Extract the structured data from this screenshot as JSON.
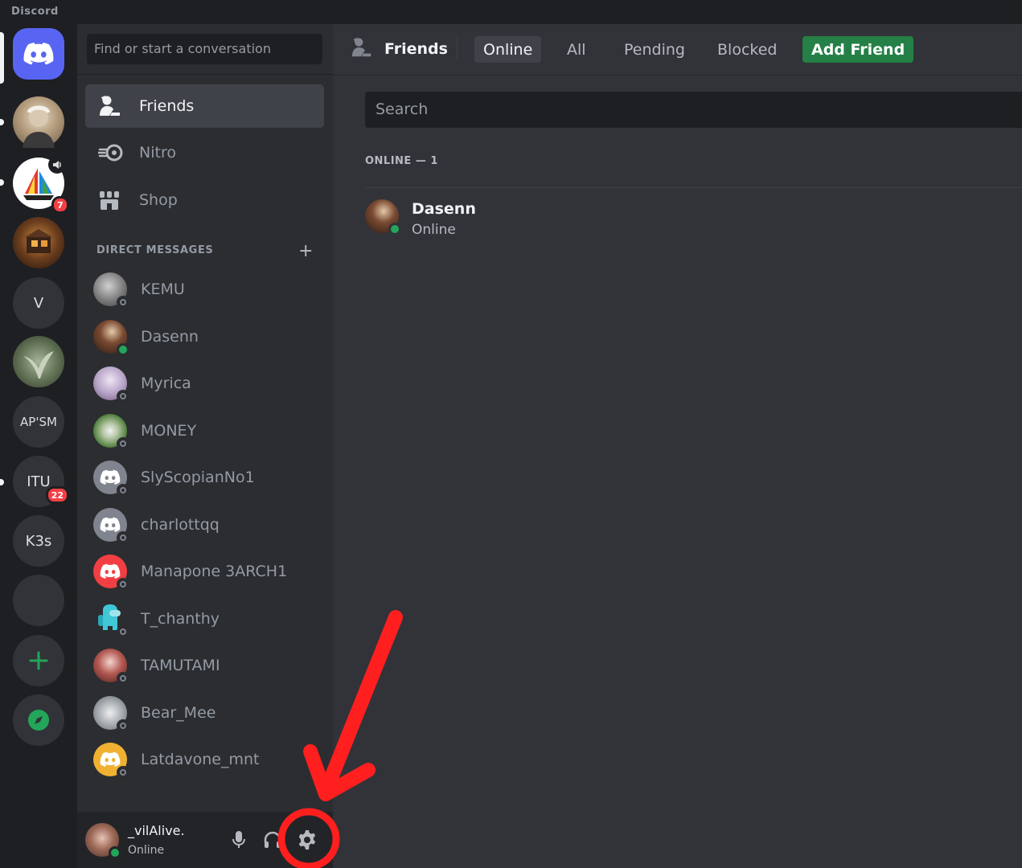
{
  "app": {
    "title": "Discord"
  },
  "colors": {
    "blurple": "#5865f2",
    "online": "#23a55a",
    "add_friend": "#248046",
    "badge": "#f23f43",
    "annotation": "#ff1f1f"
  },
  "servers": [
    {
      "id": "home",
      "icon": "discord-logo-icon"
    },
    {
      "id": "server-1",
      "avatar": "old-man-portrait",
      "unread": true
    },
    {
      "id": "server-2",
      "avatar": "rainbow-sailboat",
      "unread": true,
      "badge": "7",
      "voice": true
    },
    {
      "id": "server-3",
      "avatar": "dark-room"
    },
    {
      "id": "server-v",
      "label": "V"
    },
    {
      "id": "server-5",
      "avatar": "plant-photo"
    },
    {
      "id": "server-apsm",
      "label": "AP'SM"
    },
    {
      "id": "server-itu",
      "label": "ITU",
      "unread": true,
      "badge": "22"
    },
    {
      "id": "server-k3s",
      "label": "K3s"
    },
    {
      "id": "server-blank",
      "label": ""
    },
    {
      "id": "add-server",
      "icon": "plus-icon"
    },
    {
      "id": "explore",
      "icon": "compass-icon"
    }
  ],
  "sidebar": {
    "search_placeholder": "Find or start a conversation",
    "nav": [
      {
        "label": "Friends",
        "icon": "friends-icon",
        "active": true
      },
      {
        "label": "Nitro",
        "icon": "nitro-icon"
      },
      {
        "label": "Shop",
        "icon": "shop-icon"
      }
    ],
    "dm_header": "DIRECT MESSAGES",
    "dms": [
      {
        "name": "KEMU",
        "status": "offline",
        "avatar": "#8f9095"
      },
      {
        "name": "Dasenn",
        "status": "online",
        "avatar": "#6b4a3a"
      },
      {
        "name": "Myrica",
        "status": "offline",
        "avatar": "#b9a6c9"
      },
      {
        "name": "MONEY",
        "status": "offline",
        "avatar": "#5d8f47"
      },
      {
        "name": "SlyScopianNo1",
        "status": "offline",
        "avatar": "#80848e",
        "discord_default": true
      },
      {
        "name": "charlottqq",
        "status": "offline",
        "avatar": "#80848e",
        "discord_default": true
      },
      {
        "name": "Manapone 3ARCH1",
        "status": "offline",
        "avatar": "#f23f43",
        "discord_default": true
      },
      {
        "name": "T_chanthy",
        "status": "offline",
        "avatar": "#3fb8c9"
      },
      {
        "name": "TAMUTAMI",
        "status": "offline",
        "avatar": "#a0524e"
      },
      {
        "name": "Bear_Mee",
        "status": "offline",
        "avatar": "#9ea3a8"
      },
      {
        "name": "Latdavone_mnt",
        "status": "offline",
        "avatar": "#f0b132",
        "discord_default": true
      }
    ]
  },
  "user": {
    "name": "_vilAlive.",
    "status": "Online"
  },
  "main": {
    "title": "Friends",
    "tabs": [
      {
        "label": "Online",
        "selected": true
      },
      {
        "label": "All"
      },
      {
        "label": "Pending"
      },
      {
        "label": "Blocked"
      },
      {
        "label": "Add Friend",
        "primary": true
      }
    ],
    "search_placeholder": "Search",
    "online_header": "ONLINE — 1",
    "friends": [
      {
        "name": "Dasenn",
        "status": "Online"
      }
    ]
  }
}
